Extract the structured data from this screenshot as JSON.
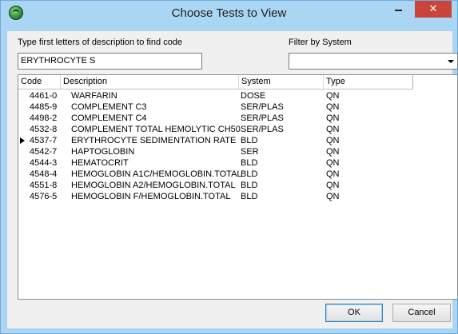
{
  "window": {
    "title": "Choose Tests to View",
    "close_label": "✕"
  },
  "search": {
    "label": "Type first letters of description to find code",
    "value": "ERYTHROCYTE S"
  },
  "filter": {
    "label": "Filter by System",
    "value": ""
  },
  "grid": {
    "columns": [
      "Code",
      "Description",
      "System",
      "Type"
    ],
    "rows": [
      {
        "code": "4461-0",
        "description": "WARFARIN",
        "system": "DOSE",
        "type": "QN",
        "current": false
      },
      {
        "code": "4485-9",
        "description": "COMPLEMENT C3",
        "system": "SER/PLAS",
        "type": "QN",
        "current": false
      },
      {
        "code": "4498-2",
        "description": "COMPLEMENT C4",
        "system": "SER/PLAS",
        "type": "QN",
        "current": false
      },
      {
        "code": "4532-8",
        "description": "COMPLEMENT TOTAL HEMOLYTIC CH50",
        "system": "SER/PLAS",
        "type": "QN",
        "current": false
      },
      {
        "code": "4537-7",
        "description": "ERYTHROCYTE SEDIMENTATION RATE",
        "system": "BLD",
        "type": "QN",
        "current": true
      },
      {
        "code": "4542-7",
        "description": "HAPTOGLOBIN",
        "system": "SER",
        "type": "QN",
        "current": false
      },
      {
        "code": "4544-3",
        "description": "HEMATOCRIT",
        "system": "BLD",
        "type": "QN",
        "current": false
      },
      {
        "code": "4548-4",
        "description": "HEMOGLOBIN A1C/HEMOGLOBIN.TOTAL",
        "system": "BLD",
        "type": "QN",
        "current": false
      },
      {
        "code": "4551-8",
        "description": "HEMOGLOBIN A2/HEMOGLOBIN.TOTAL",
        "system": "BLD",
        "type": "QN",
        "current": false
      },
      {
        "code": "4576-5",
        "description": "HEMOGLOBIN F/HEMOGLOBIN.TOTAL",
        "system": "BLD",
        "type": "QN",
        "current": false
      }
    ]
  },
  "buttons": {
    "ok": "OK",
    "cancel": "Cancel"
  }
}
